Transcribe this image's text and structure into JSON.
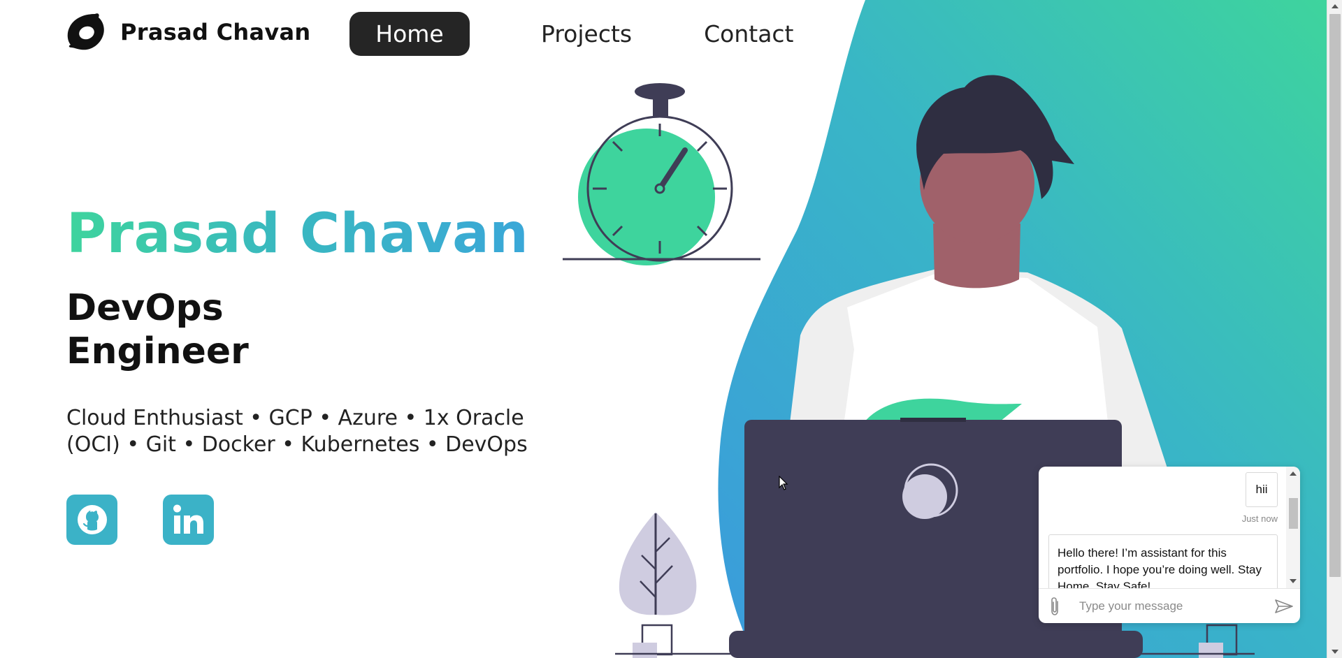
{
  "brand": {
    "name": "Prasad Chavan",
    "logo_icon": "swirl-logo-icon"
  },
  "nav": {
    "items": [
      {
        "label": "Home",
        "active": true
      },
      {
        "label": "Projects",
        "active": false
      },
      {
        "label": "Contact",
        "active": false
      }
    ]
  },
  "hero": {
    "name": "Prasad Chavan",
    "role_line1": "DevOps",
    "role_line2": "Engineer",
    "tagline_line1": "Cloud Enthusiast • GCP • Azure • 1x Oracle",
    "tagline_line2": "(OCI) • Git • Docker • Kubernetes • DevOps"
  },
  "social": [
    {
      "icon": "github-icon"
    },
    {
      "icon": "linkedin-icon"
    }
  ],
  "chat": {
    "user_message": "hii",
    "user_time": "Just now",
    "bot_message": "Hello there! I’m assistant for this portfolio. I hope you’re doing well. Stay Home, Stay Safe!",
    "input_placeholder": "Type your message",
    "attach_icon": "paperclip-icon",
    "send_icon": "send-icon"
  },
  "colors": {
    "accent_green": "#3ed49d",
    "accent_blue": "#3aa7d8",
    "dark": "#252525",
    "laptop": "#3f3d56",
    "social_bg": "#3bb2c7"
  }
}
